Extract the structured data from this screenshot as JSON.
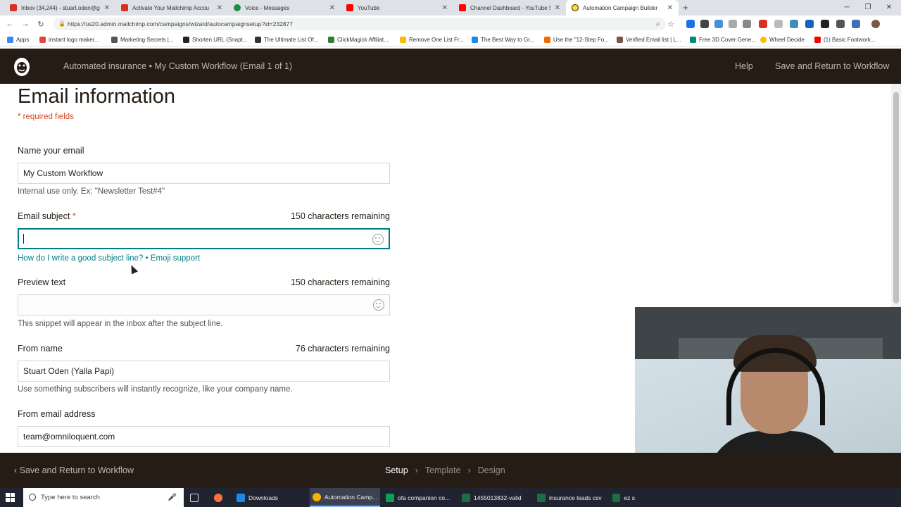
{
  "browser": {
    "tabs": [
      {
        "title": "Inbox (34,244) - stuart.oden@gm",
        "color": "#d93025"
      },
      {
        "title": "Activate Your Mailchimp Accou",
        "color": "#d93025"
      },
      {
        "title": "Voice - Messages",
        "color": "#1e8e3e"
      },
      {
        "title": "YouTube",
        "color": "#ff0000"
      },
      {
        "title": "Channel Dashboard - YouTube S",
        "color": "#ff0000"
      },
      {
        "title": "Automation Campaign Builder",
        "color": "#ffe01b"
      }
    ],
    "url": "https://us20.admin.mailchimp.com/campaigns/wizard/autocampaignsetup?id=232877",
    "bookmarks": [
      "Apps",
      "instant logo maker...",
      "Marketing Secrets |...",
      "Shorten URL (Snapt...",
      "The Ultimate List Of...",
      "ClickMagick Affiliat...",
      "Remove One List Fr...",
      "The Best Way to Gr...",
      "Use the \"12-Step Fo...",
      "Verified Email list | L...",
      "Free 3D Cover Gene...",
      "Wheel Decide",
      "(1) Basic Footwork..."
    ]
  },
  "header": {
    "breadcrumb": "Automated insurance • My Custom Workflow (Email 1 of 1)",
    "help": "Help",
    "save_return": "Save and Return to Workflow"
  },
  "form": {
    "title": "Email information",
    "required_note": "* required fields",
    "name": {
      "label": "Name your email",
      "value": "My Custom Workflow",
      "hint": "Internal use only. Ex: \"Newsletter Test#4\""
    },
    "subject": {
      "label": "Email subject",
      "required_mark": "*",
      "remaining": "150 characters remaining",
      "value": "",
      "link_good_subject": "How do I write a good subject line?",
      "link_separator": "•",
      "link_emoji": "Emoji support"
    },
    "preview": {
      "label": "Preview text",
      "remaining": "150 characters remaining",
      "value": "",
      "hint": "This snippet will appear in the inbox after the subject line."
    },
    "from_name": {
      "label": "From name",
      "remaining": "76 characters remaining",
      "value": "Stuart Oden (Yalla Papi)",
      "hint": "Use something subscribers will instantly recognize, like your company name."
    },
    "from_email": {
      "label": "From email address",
      "value": "team@omniloquent.com"
    }
  },
  "footer": {
    "back": "Save and Return to Workflow",
    "steps": [
      "Setup",
      "Template",
      "Design"
    ],
    "current_step": "Setup"
  },
  "taskbar": {
    "search_placeholder": "Type here to search",
    "items": [
      {
        "label": "Downloads",
        "color": "#1e88e5"
      },
      {
        "label": "Automation Camp...",
        "color": "#f4b400"
      },
      {
        "label": "ofa companion co...",
        "color": "#0f9d58"
      },
      {
        "label": "1455013832-valid",
        "color": "#1d6f42"
      },
      {
        "label": "insurance leads csv",
        "color": "#1d6f42"
      },
      {
        "label": "ez s",
        "color": "#1d6f42"
      }
    ]
  },
  "colors": {
    "brand_dark": "#241c15",
    "accent_teal": "#007c89",
    "required_red": "#d14a24"
  }
}
